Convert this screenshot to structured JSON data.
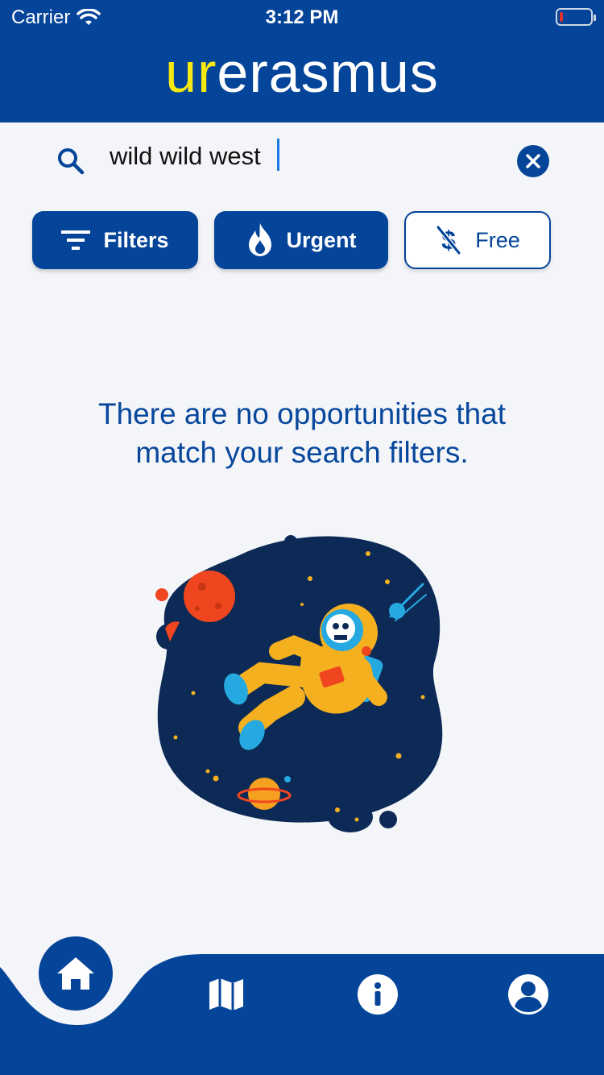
{
  "status_bar": {
    "carrier": "Carrier",
    "time": "3:12 PM"
  },
  "header": {
    "logo_accent": "ur",
    "logo_rest": "erasmus"
  },
  "search": {
    "value": "wild wild west"
  },
  "filters": [
    {
      "label": "Filters",
      "icon": "filter-lines-icon",
      "style": "solid"
    },
    {
      "label": "Urgent",
      "icon": "flame-icon",
      "style": "solid"
    },
    {
      "label": "Free",
      "icon": "no-dollar-icon",
      "style": "outline"
    }
  ],
  "empty_state": {
    "line1": "There are no opportunities that",
    "line2": "match your search filters.",
    "illustration": "astronaut-in-space-illustration"
  },
  "bottom_nav": [
    {
      "name": "home",
      "icon": "home-icon",
      "active": true
    },
    {
      "name": "map",
      "icon": "map-icon",
      "active": false
    },
    {
      "name": "info",
      "icon": "info-icon",
      "active": false
    },
    {
      "name": "profile",
      "icon": "user-icon",
      "active": false
    }
  ],
  "colors": {
    "primary": "#044499",
    "accent_yellow": "#f5e90f",
    "background": "#f3f5f8"
  }
}
